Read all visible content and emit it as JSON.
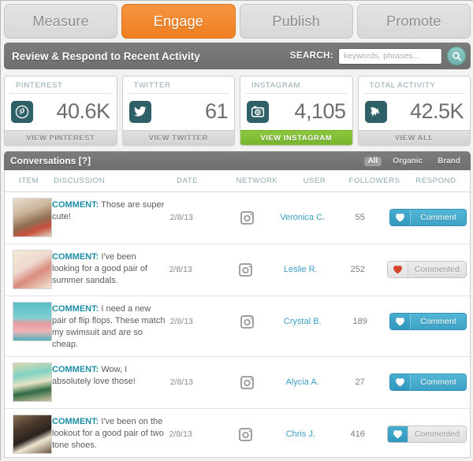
{
  "tabs": [
    {
      "label": "Measure",
      "active": false
    },
    {
      "label": "Engage",
      "active": true
    },
    {
      "label": "Publish",
      "active": false
    },
    {
      "label": "Promote",
      "active": false
    }
  ],
  "header": {
    "title": "Review & Respond to Recent Activity",
    "search_label": "SEARCH:",
    "search_value": "",
    "search_placeholder": "keywords, phrases...",
    "search_icon": "search-icon"
  },
  "cards": [
    {
      "label": "PINTEREST",
      "value": "40.6K",
      "foot": "VIEW PINTEREST",
      "icon": "pinterest-icon",
      "active": false,
      "badge_color": "#2d6167"
    },
    {
      "label": "TWITTER",
      "value": "61",
      "foot": "VIEW TWITTER",
      "icon": "twitter-icon",
      "active": false,
      "badge_color": "#2d6167"
    },
    {
      "label": "INSTAGRAM",
      "value": "4,105",
      "foot": "VIEW INSTAGRAM",
      "icon": "instagram-icon",
      "active": true,
      "badge_color": "#2d6167"
    },
    {
      "label": "TOTAL ACTIVITY",
      "value": "42.5K",
      "foot": "VIEW ALL",
      "icon": "bird-icon",
      "active": false,
      "badge_color": "#2d6167"
    }
  ],
  "panel": {
    "title": "Conversations [?]",
    "filters": [
      {
        "label": "All",
        "active": true
      },
      {
        "label": "Organic",
        "active": false
      },
      {
        "label": "Brand",
        "active": false
      }
    ],
    "columns": {
      "item": "ITEM",
      "discussion": "DISCUSSION",
      "date": "DATE",
      "network": "NETWORK",
      "user": "USER",
      "followers": "FOLLOWERS",
      "respond": "RESPOND"
    },
    "rows": [
      {
        "label": "COMMENT:",
        "text": " Those are super cute!",
        "date": "2/8/13",
        "network": "instagram-icon",
        "user": "Veronica C.",
        "followers": "55",
        "respond_label": "Comment",
        "respond_state": "active",
        "heart": "heart-icon",
        "thumb": "legs-and-red-cart-photo"
      },
      {
        "label": "COMMENT:",
        "text": " I've been looking for a good pair of summer sandals.",
        "date": "2/8/13",
        "network": "instagram-icon",
        "user": "Leslie R.",
        "followers": "252",
        "respond_label": "Commented",
        "respond_state": "done",
        "heart": "heart-icon",
        "thumb": "pink-floral-sketch-photo"
      },
      {
        "label": "COMMENT:",
        "text": " I need a new pair of flip flops. These match my swimsuit and are so cheap.",
        "date": "2/8/13",
        "network": "instagram-icon",
        "user": "Crystal B.",
        "followers": "189",
        "respond_label": "Comment",
        "respond_state": "active",
        "heart": "heart-icon",
        "thumb": "pink-flip-flops-photo"
      },
      {
        "label": "COMMENT:",
        "text": " Wow, I absolutely love those!",
        "date": "2/8/13",
        "network": "instagram-icon",
        "user": "Alycia A.",
        "followers": "27",
        "respond_label": "Comment",
        "respond_state": "active",
        "heart": "heart-icon",
        "thumb": "green-heels-and-bag-photo"
      },
      {
        "label": "COMMENT:",
        "text": " I've been on the lookout for a good pair of two tone shoes.",
        "date": "2/8/13",
        "network": "instagram-icon",
        "user": "Chris J.",
        "followers": "416",
        "respond_label": "Commented",
        "respond_state": "mixed",
        "heart": "heart-icon",
        "thumb": "two-tone-shoes-photo"
      }
    ]
  },
  "colors": {
    "accent_orange": "#ef7f21",
    "accent_green": "#7ab82f",
    "accent_blue": "#3da3c6",
    "teal_badge": "#2d6167",
    "header_gray": "#737373",
    "link_blue": "#3a9fc4",
    "heart_red": "#d6442c"
  }
}
